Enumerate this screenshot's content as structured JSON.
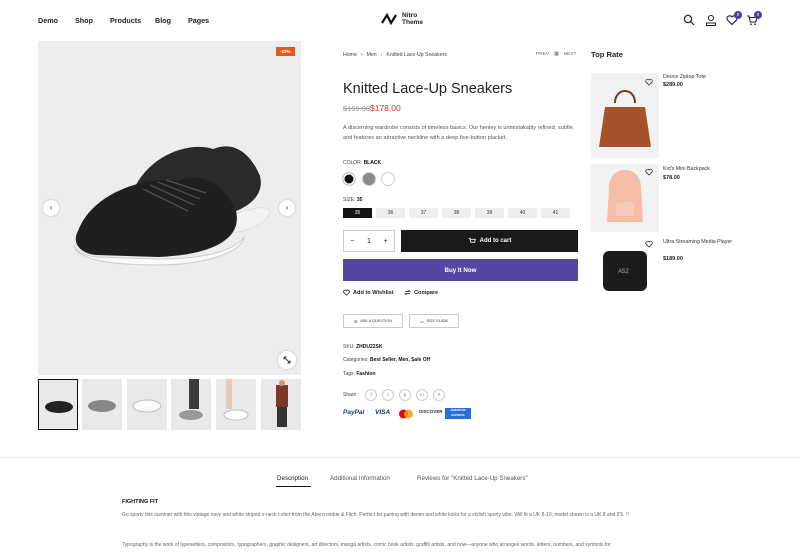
{
  "nav": {
    "items": [
      "Demo",
      "Shop",
      "Products",
      "Blog",
      "Pages"
    ]
  },
  "logo": {
    "line1": "Nitro",
    "line2": "Theme"
  },
  "header": {
    "wishlist_count": "0",
    "cart_count": "0"
  },
  "gallery": {
    "sale_badge": "-10%"
  },
  "breadcrumb": {
    "home": "Home",
    "sep1": "›",
    "category": "Men",
    "sep2": "›",
    "current": "Knitted Lace-Up Sneakers"
  },
  "pager": {
    "prev": "PREV",
    "next": "NEXT"
  },
  "product": {
    "title": "Knitted Lace-Up Sneakers",
    "old_price": "$199.00",
    "price": "$178.00",
    "description": "A discerning wardrobe consists of timeless basics. Our henley is unmistakably refined, subtle, and features an attractive neckline with a deep five-button placket.",
    "color_label": "COLOR:",
    "color_value": "BLACK",
    "size_label": "SIZE:",
    "size_value": "35",
    "sizes": [
      "35",
      "36",
      "37",
      "38",
      "39",
      "40",
      "41"
    ],
    "qty": "1",
    "add_to_cart": "Add to cart",
    "buy_now": "Buy It Now",
    "wishlist": "Add to Wishlist",
    "compare": "Compare",
    "ask": "ASK A QUESTION",
    "size_guide": "SIZE GUIDE",
    "sku_label": "SKU:",
    "sku": "ZHDU22SK",
    "cat_label": "Categories:",
    "categories": "Best Seller, Men, Sale Off",
    "tags_label": "Tags:",
    "tags": "Fashion",
    "share_label": "Share:",
    "payments": [
      "PayPal",
      "VISA",
      "",
      "DISCOVER",
      "AMERICAN EXPRESS"
    ]
  },
  "sidebar": {
    "title": "Top Rate",
    "items": [
      {
        "name": "Deuce Ziptop Tote",
        "price": "$289.00"
      },
      {
        "name": "Kid's Mini Backpack",
        "price": "$78.00"
      },
      {
        "name": "Ultra Streaming Media Player",
        "price": "$189.00"
      }
    ]
  },
  "tabs": {
    "description": "Description",
    "additional": "Additional Information",
    "reviews": "Reviews for \"Knitted Lace-Up Sneakers\""
  },
  "desc_section": {
    "heading": "FIGHTING FIT",
    "p1": "Go sporty this summer with this vintage navy and white striped v-neck t-shirt from the Abercrombie & Fitch. Perfect for pairing with denim and white kicks for a stylish sporty vibe. Will fit a UK 8-10, model shown is a UK 8 and 5'5. !!",
    "p2": "Typography is the work of typesetters, compositors, typographers, graphic designers, art directors, manga artists, comic book artists, graffiti artists, and now—anyone who arranges words, letters, numbers, and symbols for"
  }
}
